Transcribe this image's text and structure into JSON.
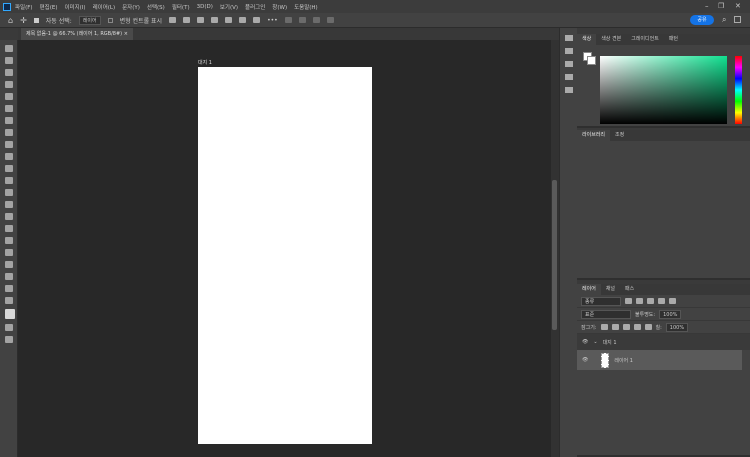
{
  "menu": [
    "파일(F)",
    "편집(E)",
    "이미지(I)",
    "레이어(L)",
    "문자(Y)",
    "선택(S)",
    "필터(T)",
    "3D(D)",
    "보기(V)",
    "플러그인",
    "창(W)",
    "도움말(H)"
  ],
  "options": {
    "auto_select_label": "자동 선택:",
    "auto_select_value": "레이어",
    "transform_controls": "변형 컨트롤 표시",
    "more": "•••",
    "share": "공유"
  },
  "document_tab": {
    "title": "제목 없음-1 @ 66.7% (레이어 1, RGB/8#)",
    "close": "×"
  },
  "artboard": {
    "name": "대지 1"
  },
  "color_panel": {
    "tabs": [
      "색상",
      "색상 견본",
      "그레이디언트",
      "패턴"
    ]
  },
  "adjust_panel": {
    "tabs": [
      "라이브러리",
      "조정"
    ]
  },
  "layers_panel": {
    "tabs": [
      "레이어",
      "채널",
      "패스"
    ],
    "filter_kind": "종류",
    "blend_mode": "표준",
    "opacity_label": "불투명도:",
    "opacity": "100%",
    "lock_label": "잠그기:",
    "fill_label": "칠:",
    "fill": "100%",
    "layers": [
      {
        "name": "대지 1",
        "type": "artboard"
      },
      {
        "name": "레이어 1",
        "type": "layer",
        "selected": true
      }
    ]
  }
}
